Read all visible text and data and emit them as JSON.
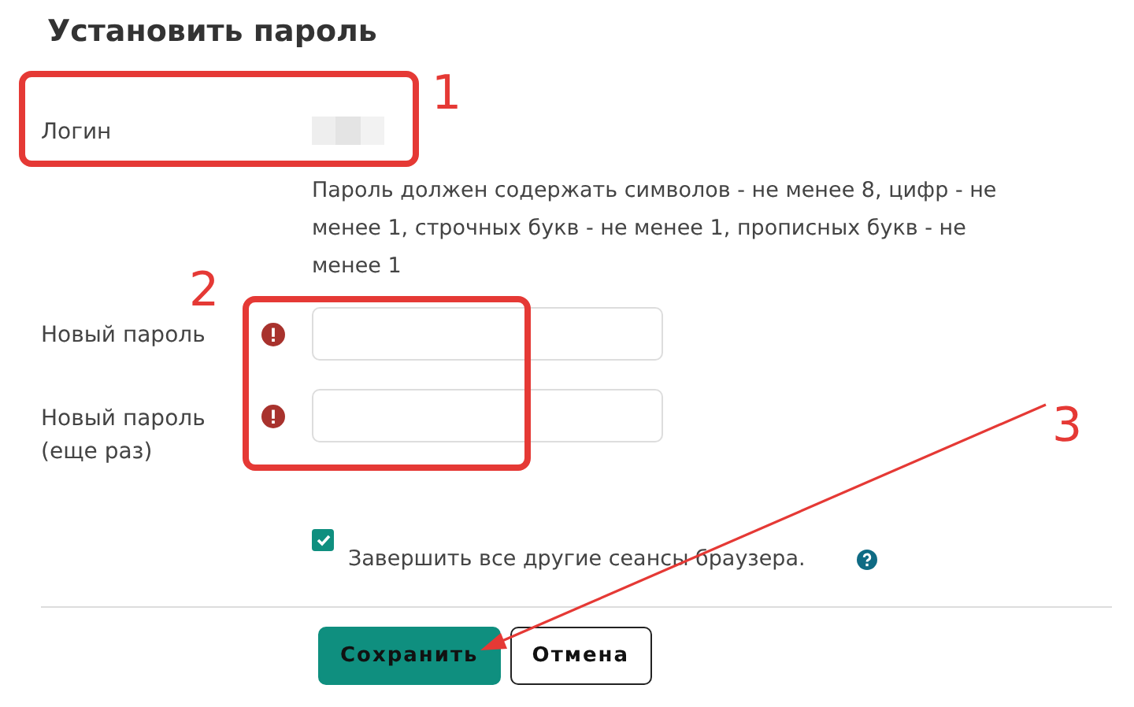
{
  "title": "Установить пароль",
  "login": {
    "label": "Логин"
  },
  "password_rules": "Пароль должен содержать символов - не менее 8, цифр - не менее 1, строчных букв - не менее 1, прописных букв - не менее 1",
  "fields": [
    {
      "label": "Новый пароль",
      "required": true
    },
    {
      "label": "Новый пароль (еще раз)",
      "required": true
    }
  ],
  "logout_others": {
    "label": "Завершить все другие сеансы браузера.",
    "checked": true
  },
  "buttons": [
    {
      "label": "Сохранить",
      "kind": "primary"
    },
    {
      "label": "Отмена",
      "kind": "secondary"
    }
  ],
  "annotations": [
    {
      "label": "1",
      "kind": "box"
    },
    {
      "label": "2",
      "kind": "box"
    },
    {
      "label": "3",
      "kind": "arrow"
    }
  ]
}
